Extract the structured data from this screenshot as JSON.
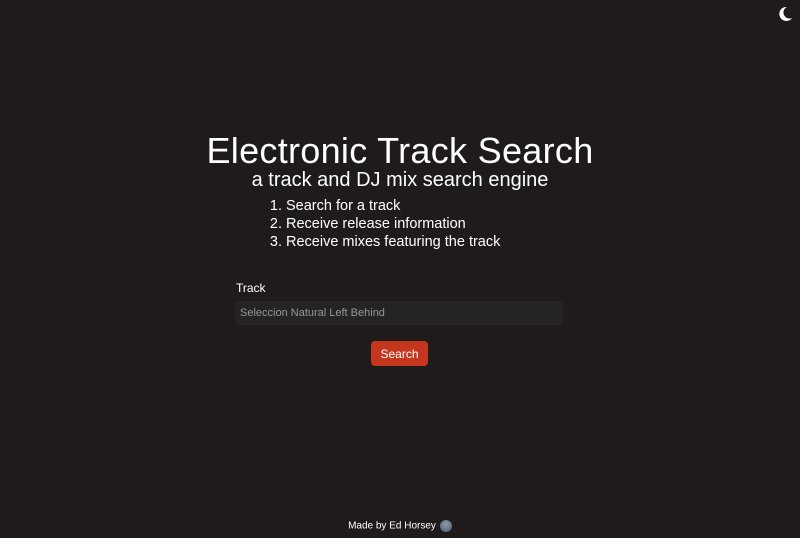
{
  "header": {
    "theme_toggle_icon": "moon-icon"
  },
  "title": "Electronic Track Search",
  "subtitle": "a track and DJ mix search engine",
  "steps": [
    "Search for a track",
    "Receive release information",
    "Receive mixes featuring the track"
  ],
  "form": {
    "label": "Track",
    "placeholder": "Seleccion Natural Left Behind",
    "value": "",
    "button": "Search"
  },
  "footer": {
    "text": "Made by Ed Horsey"
  },
  "colors": {
    "background": "#1f1b1b",
    "accent": "#c4361d"
  }
}
